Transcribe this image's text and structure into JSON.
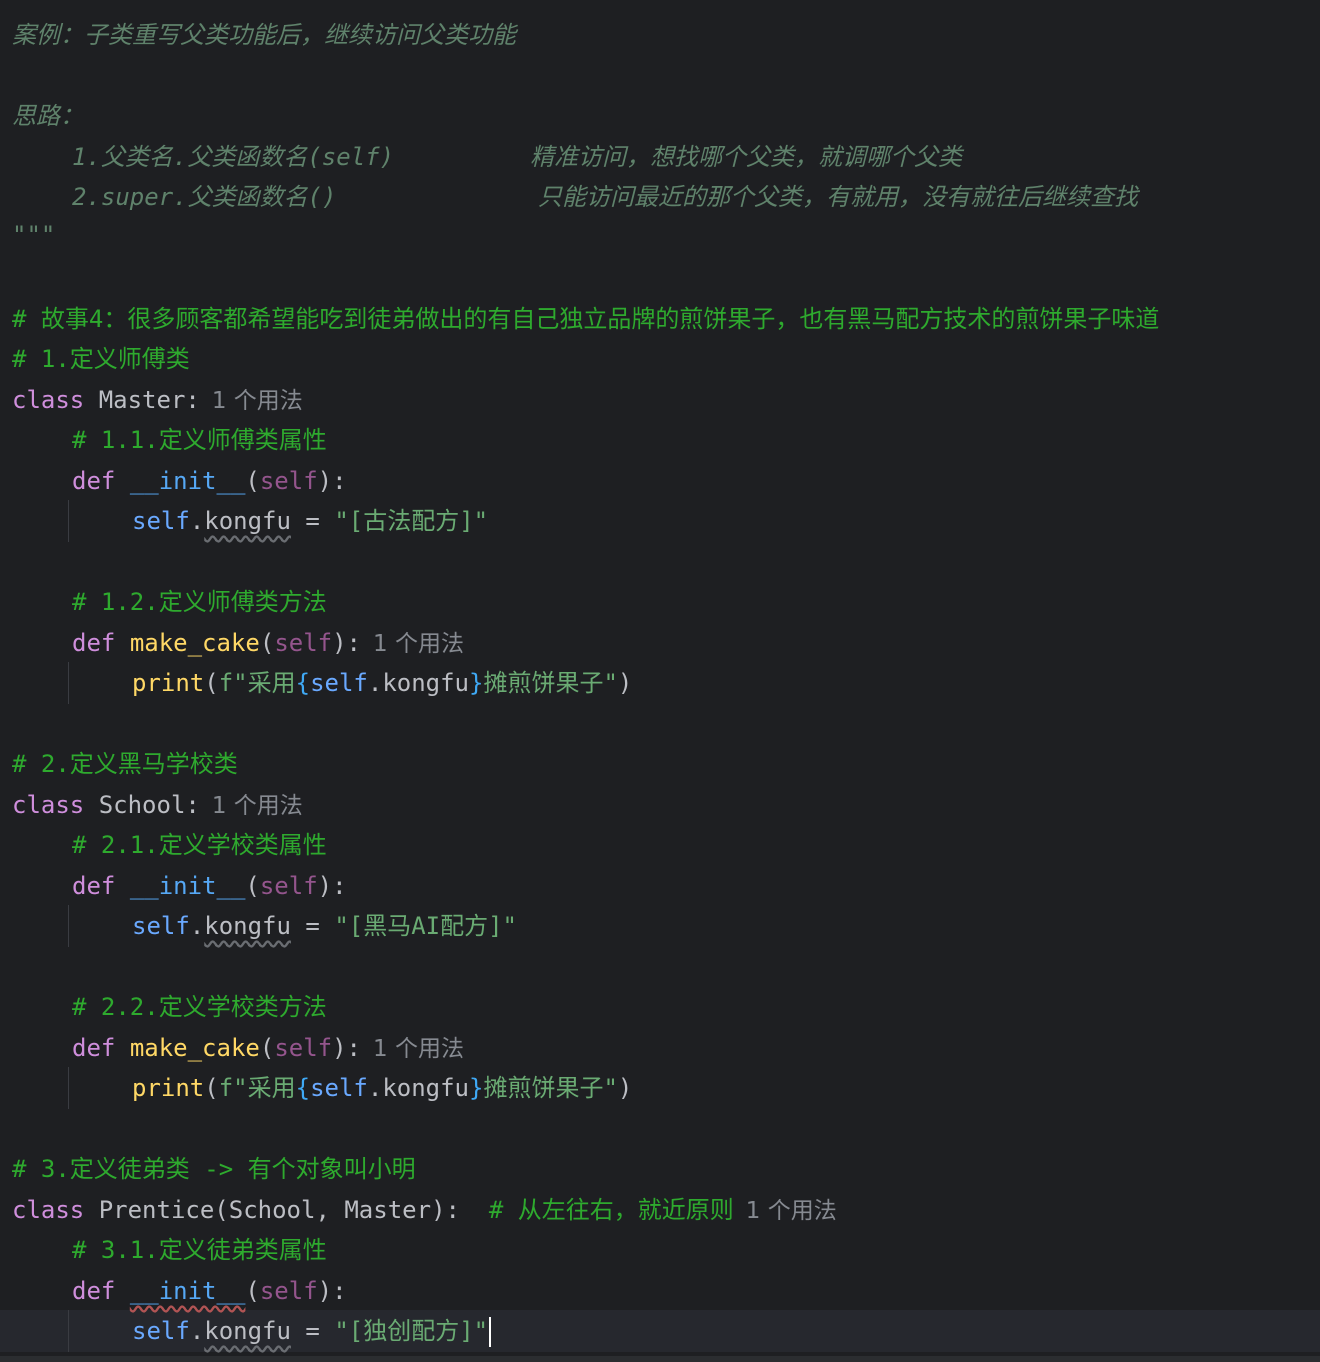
{
  "docstring": {
    "case": "案例：子类重写父类功能后，继续访问父类功能",
    "idea": "思路：",
    "method1_code": "1.父类名.父类函数名(self)",
    "method1_desc": "精准访问，想找哪个父类，就调哪个父类",
    "method2_code": "2.super.父类函数名()",
    "method2_desc": "只能访问最近的那个父类，有就用，没有就往后继续查找",
    "close": "\"\"\""
  },
  "comments": {
    "story": "# 故事4：很多顾客都希望能吃到徒弟做出的有自己独立品牌的煎饼果子，也有黑马配方技术的煎饼果子味道",
    "c1": "# 1.定义师傅类",
    "c11": "# 1.1.定义师傅类属性",
    "c12": "# 1.2.定义师傅类方法",
    "c2": "# 2.定义黑马学校类",
    "c21": "# 2.1.定义学校类属性",
    "c22": "# 2.2.定义学校类方法",
    "c3": "# 3.定义徒弟类 -> 有个对象叫小明",
    "c31": "# 3.1.定义徒弟类属性",
    "inline_mro": "# 从左往右，就近原则"
  },
  "code": {
    "kw_class": "class",
    "kw_def": "def",
    "master": "Master",
    "school": "School",
    "prentice": "Prentice",
    "init": "__init__",
    "make_cake": "make_cake",
    "self": "self",
    "kongfu": "kongfu",
    "print": "print",
    "master_kongfu": "\"[古法配方]\"",
    "school_kongfu": "\"[黑马AI配方]\"",
    "prentice_kongfu": "\"[独创配方]\"",
    "f_prefix": "f\"采用",
    "f_suffix": "摊煎饼果子\""
  },
  "hints": {
    "usage_1": "1 个用法"
  },
  "colors": {
    "background": "#1e1f22",
    "current_line": "#26282e",
    "keyword": "#cf8edc",
    "comment": "#2eaa2e",
    "docstring": "#5f826b",
    "string": "#6aab73",
    "function": "#ffd866",
    "self": "#6aa9ff"
  }
}
